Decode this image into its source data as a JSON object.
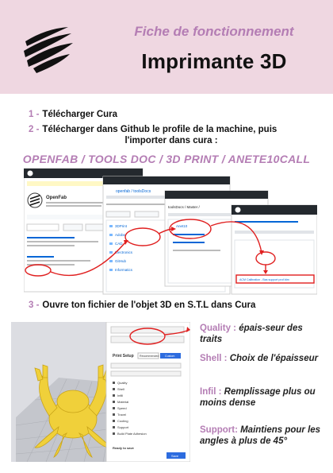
{
  "header": {
    "subtitle": "Fiche de fonctionnement",
    "title": "Imprimante 3D"
  },
  "steps": [
    {
      "num": "1 -",
      "text": "Télécharger Cura"
    },
    {
      "num": "2 -",
      "text": "Télécharger dans Github le profile de la machine, puis",
      "cont": "l'importer dans cura :"
    },
    {
      "num": "3 -",
      "text": "Ouvre ton fichier de l'objet 3D en S.T.L dans Cura"
    }
  ],
  "path": "OPENFAB / TOOLS DOC / 3D PRINT / ANETE10CALL",
  "github": {
    "org": "OpenFab",
    "repo_path": "openfab / toolsDocs",
    "master": "toolsDocs / Master /",
    "file_row": "Anet10",
    "file_hl": "ACM Calibration - Bas support prof.fdm",
    "folders": [
      "3DPrint",
      "Adobe",
      "CAD",
      "Electronics",
      "GitHub",
      "Informatics"
    ]
  },
  "cura": {
    "panel_title": "Print Setup",
    "mode_recommended": "Recommended",
    "mode_custom": "Custom",
    "sections": [
      "Quality",
      "Shell",
      "Infill",
      "Material",
      "Speed",
      "Travel",
      "Cooling",
      "Support",
      "Build Plate Adhesion"
    ],
    "ready": "Ready to save",
    "save": "Save"
  },
  "props": [
    {
      "key": "Quality :",
      "val": " épais-seur des traits"
    },
    {
      "key": "Shell :",
      "val": "     Choix de l'épaisseur"
    },
    {
      "key": "Infil :",
      "val": " Remplissage plus ou moins dense"
    },
    {
      "key": "Support:",
      "val": " Maintiens pour les angles à plus de 45°"
    }
  ]
}
